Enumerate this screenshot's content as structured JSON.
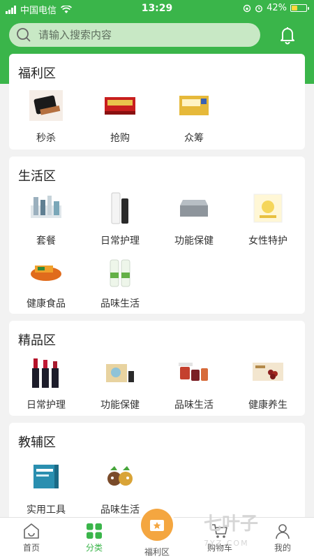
{
  "status_bar": {
    "carrier": "中国电信",
    "time": "13:29",
    "battery": "42%",
    "battery_level": 0.42
  },
  "search": {
    "placeholder": "请输入搜索内容"
  },
  "sections": [
    {
      "title": "福利区",
      "items": [
        {
          "label": "秒杀"
        },
        {
          "label": "抢购"
        },
        {
          "label": "众筹"
        }
      ]
    },
    {
      "title": "生活区",
      "items": [
        {
          "label": "套餐"
        },
        {
          "label": "日常护理"
        },
        {
          "label": "功能保健"
        },
        {
          "label": "女性特护"
        },
        {
          "label": "健康食品"
        },
        {
          "label": "品味生活"
        }
      ]
    },
    {
      "title": "精品区",
      "items": [
        {
          "label": "日常护理"
        },
        {
          "label": "功能保健"
        },
        {
          "label": "品味生活"
        },
        {
          "label": "健康养生"
        }
      ]
    },
    {
      "title": "教辅区",
      "items": [
        {
          "label": "实用工具"
        },
        {
          "label": "品味生活"
        }
      ]
    }
  ],
  "tabbar": {
    "home": "首页",
    "category": "分类",
    "welfare": "福利区",
    "cart": "购物车",
    "mine": "我的"
  },
  "watermark": {
    "text": "七叶子",
    "sub": "7YZ.COM"
  },
  "colors": {
    "brand": "#3ab54a",
    "accent": "#f4a640"
  }
}
